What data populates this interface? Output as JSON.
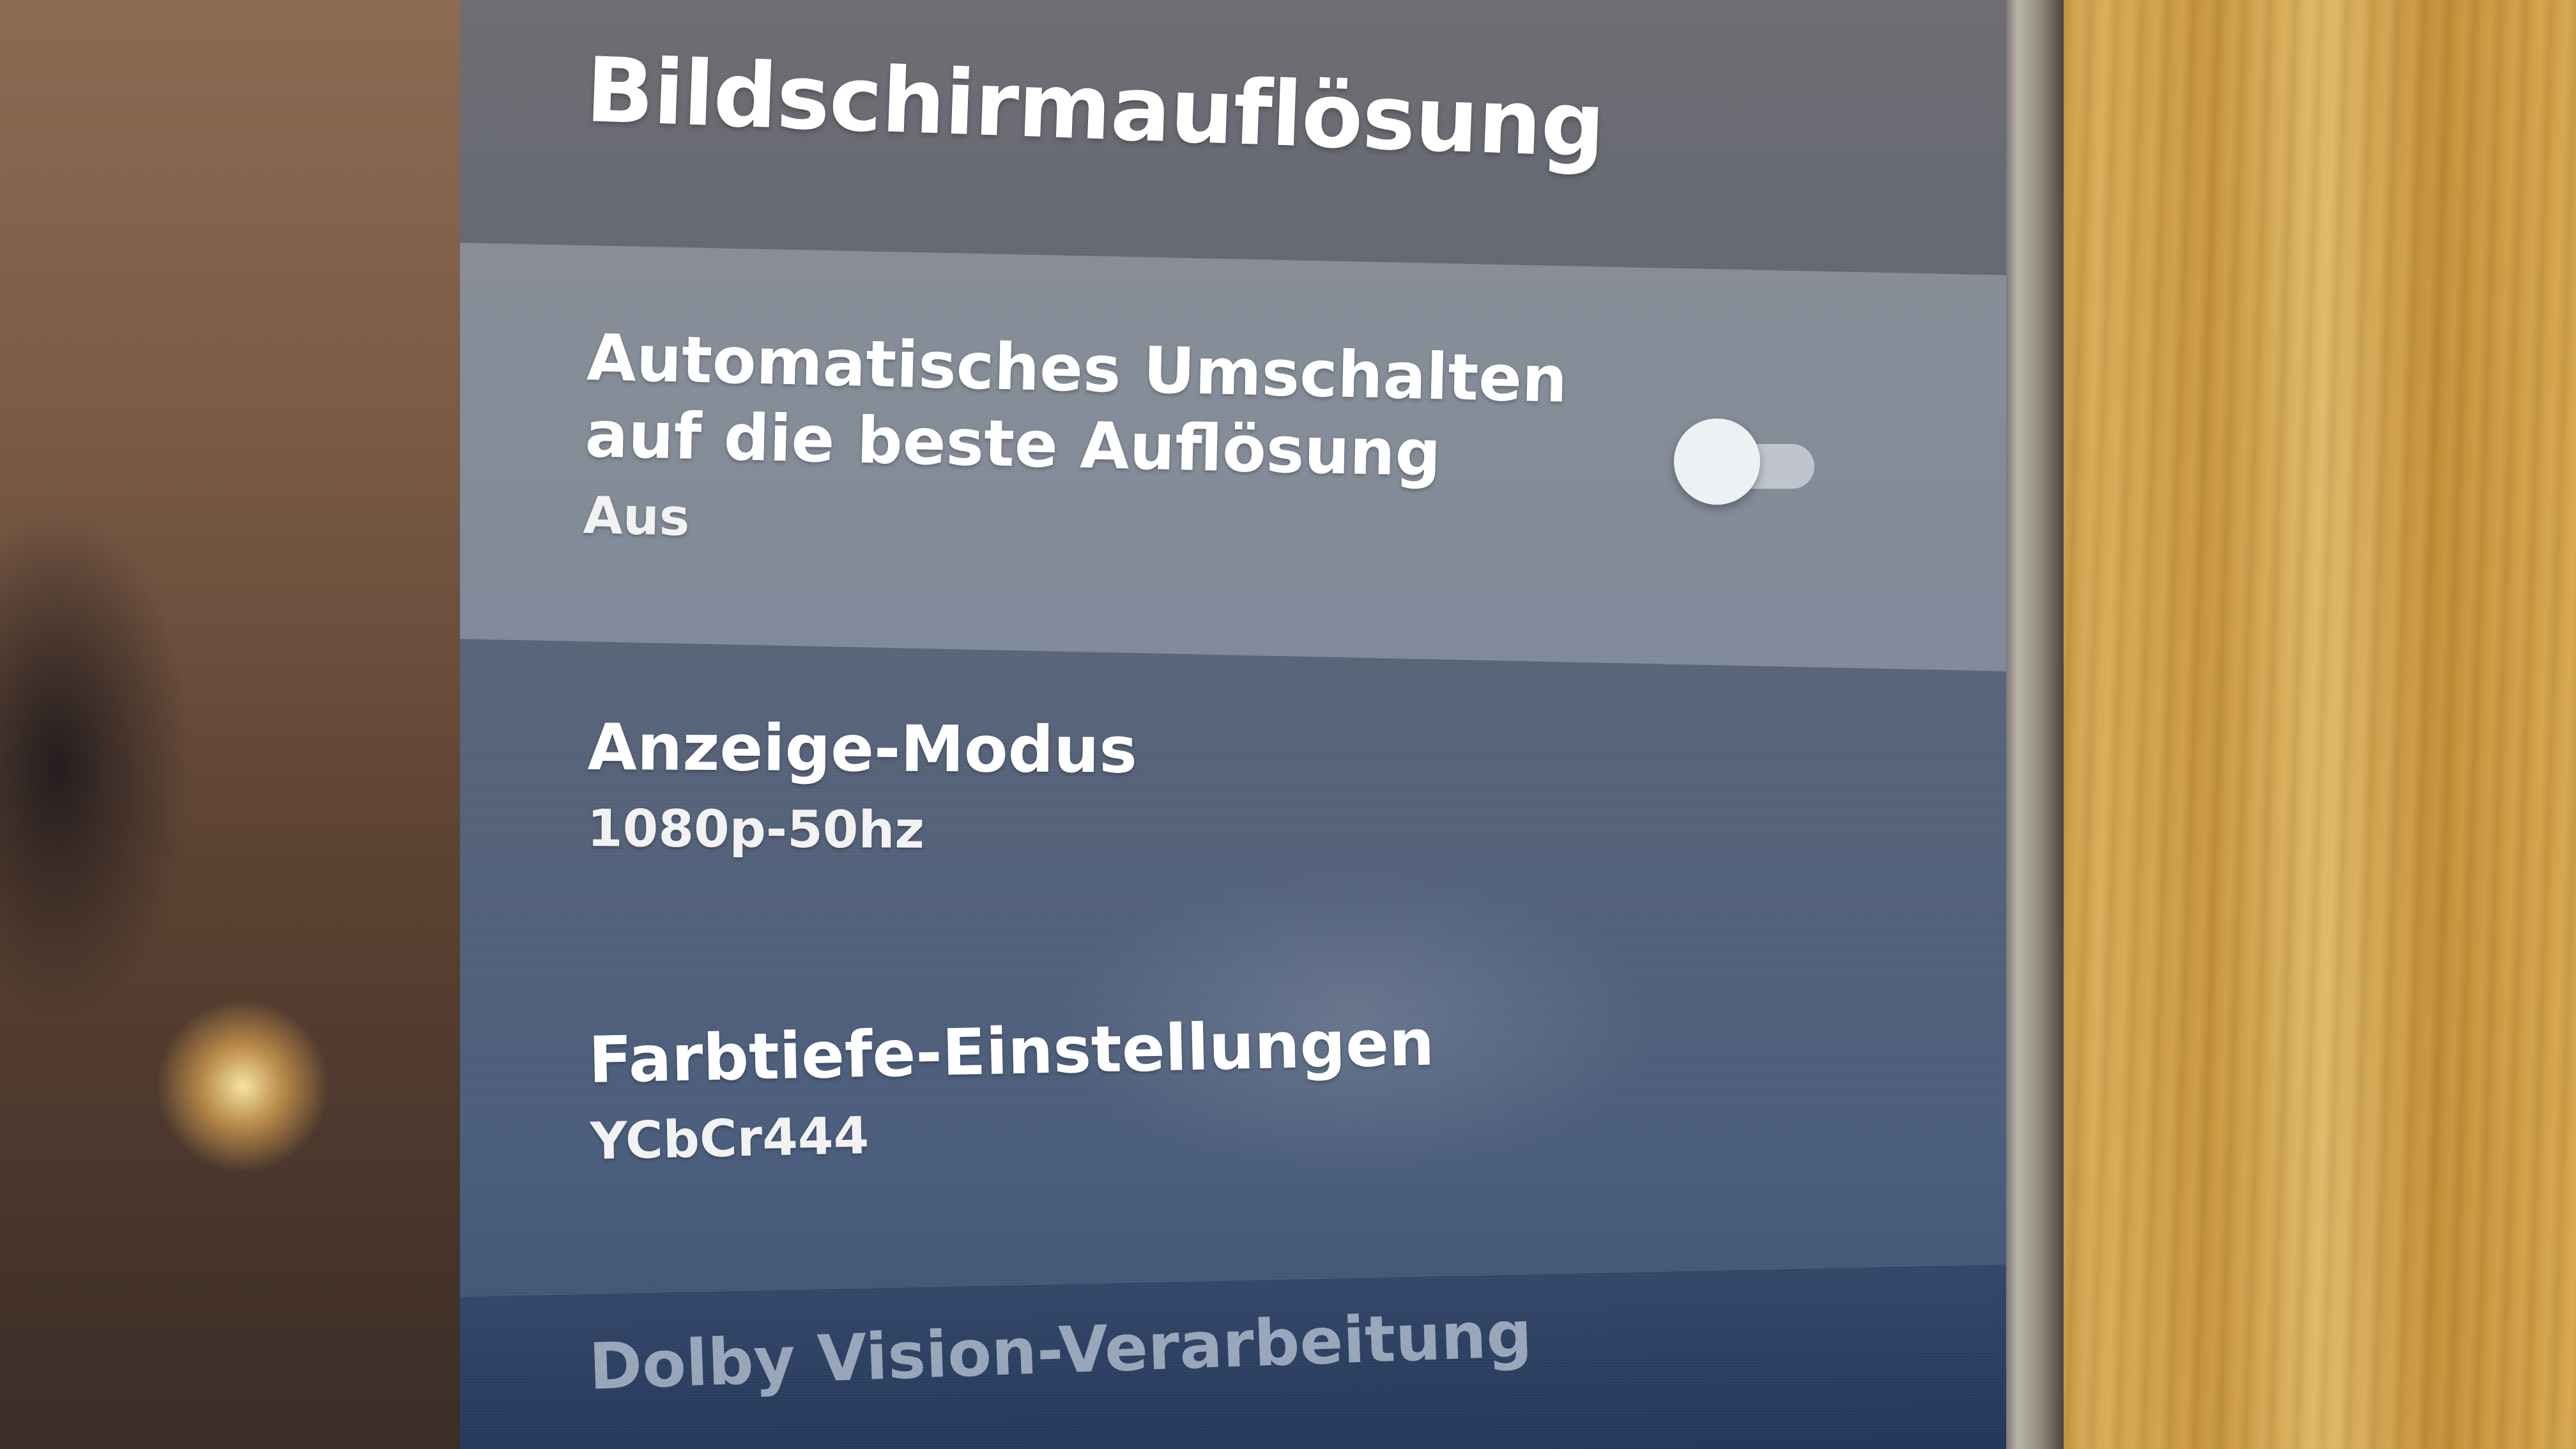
{
  "settings": {
    "title": "Bildschirmauflösung",
    "items": [
      {
        "title": "Automatisches Umschalten auf die beste Auflösung",
        "value": "Aus",
        "toggle_on": false
      },
      {
        "title": "Anzeige-Modus",
        "value": "1080p-50hz"
      },
      {
        "title": "Farbtiefe-Einstellungen",
        "value": "YCbCr444"
      },
      {
        "title": "Dolby Vision-Verarbeitung"
      }
    ]
  }
}
